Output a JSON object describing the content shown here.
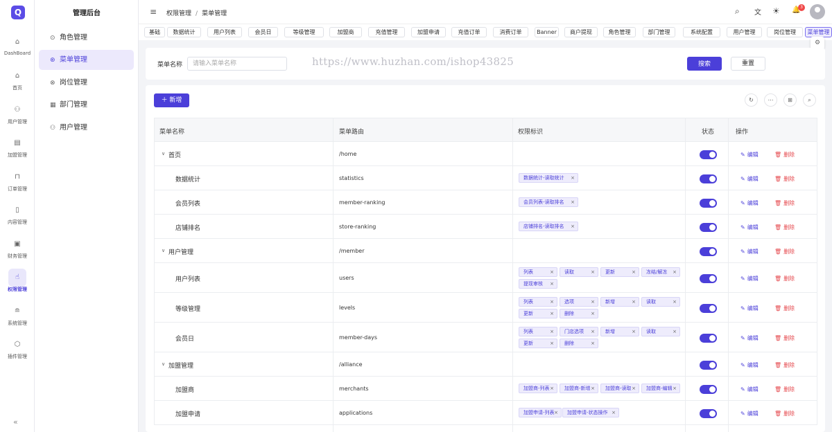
{
  "app": {
    "logo_text": "Q",
    "title": "管理后台"
  },
  "rail": [
    {
      "label": "DashBoard",
      "icon": "⌂"
    },
    {
      "label": "首页",
      "icon": "⌂"
    },
    {
      "label": "用户管理",
      "icon": "⚇"
    },
    {
      "label": "加盟管理",
      "icon": "▤"
    },
    {
      "label": "订单管理",
      "icon": "⊓"
    },
    {
      "label": "内容管理",
      "icon": "▯"
    },
    {
      "label": "财务管理",
      "icon": "▣"
    },
    {
      "label": "权限管理",
      "icon": "☝",
      "active": true
    },
    {
      "label": "系统管理",
      "icon": "≘"
    },
    {
      "label": "插件管理",
      "icon": "⬡"
    }
  ],
  "rail_collapse_icon": "«",
  "submenu": [
    {
      "label": "角色管理",
      "icon": "⊙"
    },
    {
      "label": "菜单管理",
      "icon": "⊛",
      "active": true
    },
    {
      "label": "岗位管理",
      "icon": "⊗"
    },
    {
      "label": "部门管理",
      "icon": "▦"
    },
    {
      "label": "用户管理",
      "icon": "⚇"
    }
  ],
  "header": {
    "menu_icon": "≡",
    "breadcrumb": [
      "权限管理",
      "菜单管理"
    ],
    "breadcrumb_sep": "/",
    "icons": {
      "search": "⌕",
      "translate": "文",
      "theme": "☀",
      "bell": "🔔"
    },
    "notification_count": "3"
  },
  "tabs": [
    "基础",
    "数据统计",
    "用户列表",
    "会员日",
    "等级管理",
    "加盟商",
    "充值管理",
    "加盟申请",
    "充值订单",
    "消费订单",
    "Banner",
    "商户提现",
    "角色管理",
    "部门管理",
    "系统配置",
    "用户管理",
    "岗位管理",
    "菜单管理"
  ],
  "active_tab": "菜单管理",
  "search": {
    "label": "菜单名称",
    "placeholder": "请输入菜单名称",
    "value": "",
    "search_label": "搜索",
    "reset_label": "重置"
  },
  "watermark": "https://www.huzhan.com/ishop43825",
  "toolbar": {
    "add_label": "＋ 新增",
    "icons": [
      "↻",
      "⋯",
      "⊞",
      "⌕"
    ]
  },
  "table": {
    "headers": [
      "菜单名称",
      "菜单路由",
      "权限标识",
      "状态",
      "操作"
    ],
    "edit_label": "编辑",
    "delete_label": "删除",
    "rows": [
      {
        "name": "首页",
        "route": "/home",
        "parent": true,
        "tags": []
      },
      {
        "name": "数据统计",
        "route": "statistics",
        "tags": [
          "数据统计-读取统计"
        ]
      },
      {
        "name": "会员列表",
        "route": "member-ranking",
        "tags": [
          "会员列表-读取排名"
        ]
      },
      {
        "name": "店铺排名",
        "route": "store-ranking",
        "tags": [
          "店铺排名-读取排名"
        ]
      },
      {
        "name": "用户管理",
        "route": "/member",
        "parent": true,
        "tags": []
      },
      {
        "name": "用户列表",
        "route": "users",
        "tags": [
          "列表",
          "读取",
          "更新",
          "冻结/解冻",
          "提现审核"
        ]
      },
      {
        "name": "等级管理",
        "route": "levels",
        "tags": [
          "列表",
          "选项",
          "新增",
          "读取",
          "更新",
          "删除"
        ]
      },
      {
        "name": "会员日",
        "route": "member-days",
        "tags": [
          "列表",
          "门店选项",
          "新增",
          "读取",
          "更新",
          "删除"
        ]
      },
      {
        "name": "加盟管理",
        "route": "/alliance",
        "parent": true,
        "tags": []
      },
      {
        "name": "加盟商",
        "route": "merchants",
        "tags": [
          "加盟商-列表",
          "加盟商-新增",
          "加盟商-读取",
          "加盟商-编辑"
        ]
      },
      {
        "name": "加盟申请",
        "route": "applications",
        "tags": [
          "加盟申请-列表",
          "加盟申请-状态操作"
        ]
      }
    ]
  }
}
